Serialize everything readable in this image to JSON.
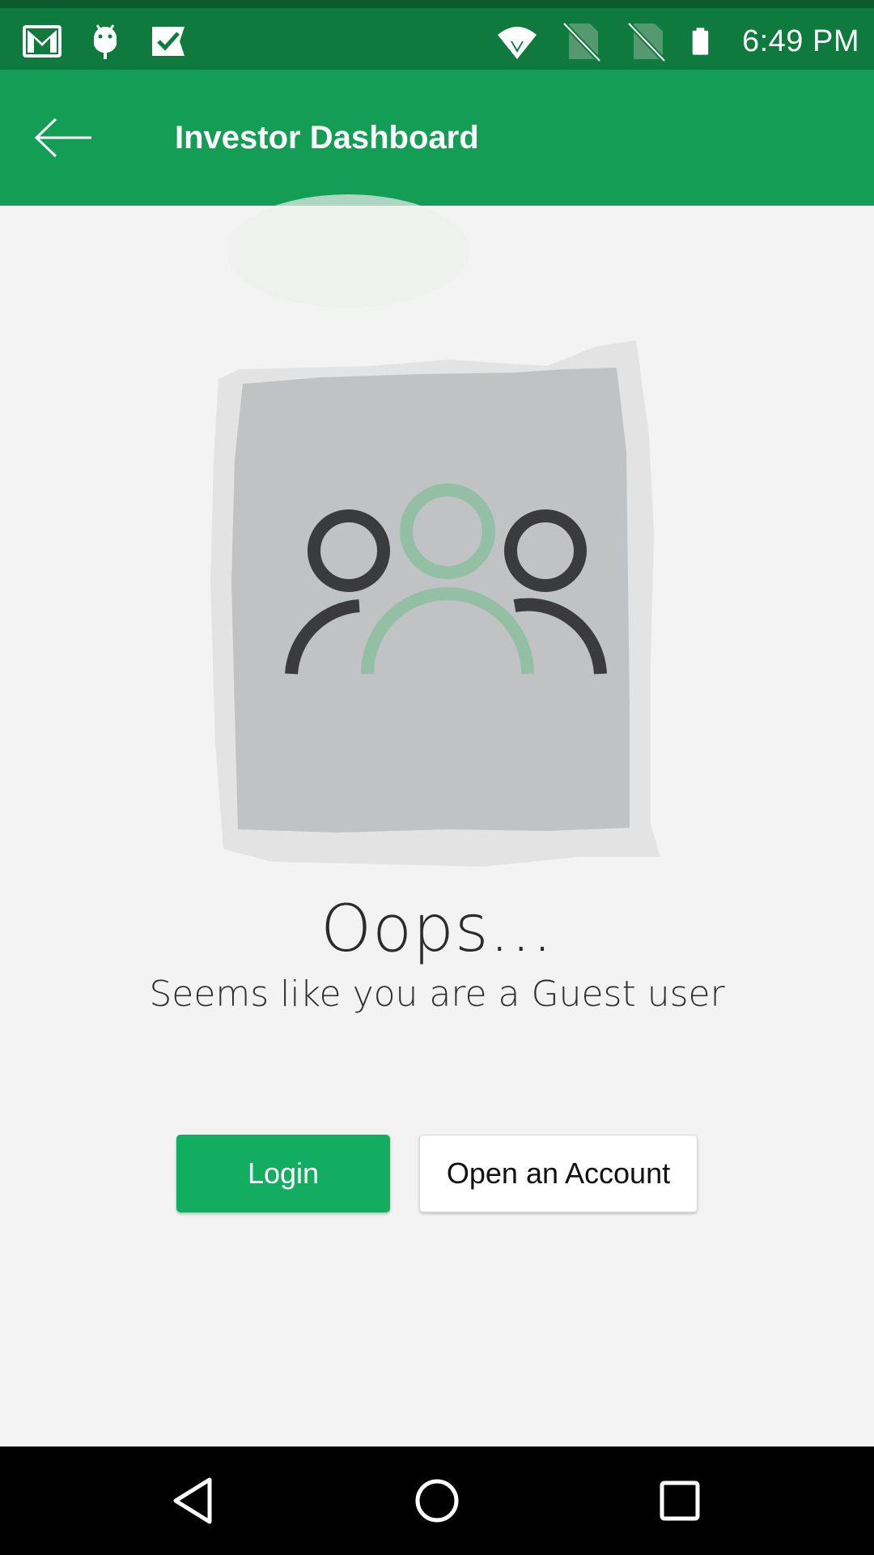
{
  "status_bar": {
    "time": "6:49 PM",
    "left_icons": [
      "gmail-icon",
      "android-debug-icon",
      "task-check-icon"
    ],
    "right_icons": [
      "wifi-icon",
      "no-sim-icon",
      "no-sim-icon",
      "battery-icon"
    ]
  },
  "app_bar": {
    "back_icon": "arrow-left-icon",
    "title": "Investor Dashboard",
    "color": "#149e55"
  },
  "illustration": {
    "icon": "users-group-icon",
    "accent": "#93bfa4"
  },
  "message": {
    "title": "Oops...",
    "subtitle": "Seems like you are a Guest user"
  },
  "actions": {
    "login_label": "Login",
    "open_account_label": "Open an Account",
    "primary_color": "#12ad60"
  },
  "nav_bar": {
    "icons": [
      "back-triangle-icon",
      "home-circle-icon",
      "recents-square-icon"
    ]
  }
}
